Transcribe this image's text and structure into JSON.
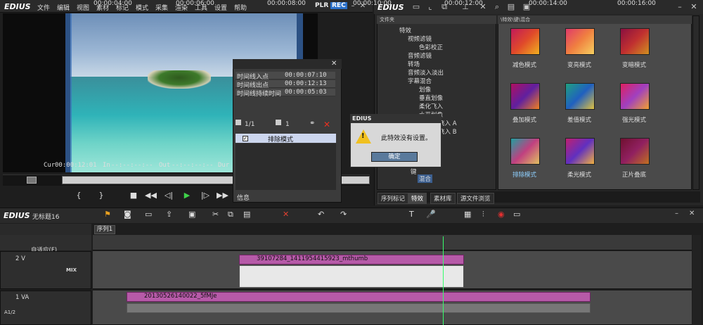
{
  "app": {
    "name": "EDIUS"
  },
  "menu": [
    "文件",
    "编辑",
    "视图",
    "素材",
    "标记",
    "模式",
    "采集",
    "渲染",
    "工具",
    "设置",
    "帮助"
  ],
  "player_badges": {
    "plr": "PLR",
    "rec": "REC"
  },
  "timecodes": {
    "cur_label": "Cur",
    "cur": "00:00:12:01",
    "in_label": "In",
    "in": "--:--:--:--",
    "out_label": "Out",
    "out": "--:--:--:--",
    "dur_label": "Dur"
  },
  "folder_panel": {
    "header": "文件夹",
    "items": [
      "特效",
      "视频滤镜",
      "色彩校正",
      "音频滤镜",
      "转场",
      "音频淡入淡出",
      "字幕混合",
      "划像",
      "垂直划像",
      "柔化飞入",
      "水平划像",
      "飞入 A",
      "飞入 B",
      "键",
      "混合"
    ]
  },
  "fx_panel": {
    "header": "\\特效\\键\\混合",
    "items": [
      "减色模式",
      "变亮模式",
      "变暗模式",
      "叠加模式",
      "差值模式",
      "强光模式",
      "排除模式",
      "柔光模式",
      "正片叠底"
    ],
    "selected": "排除模式"
  },
  "tabs": [
    "序列标记",
    "特效",
    "素材库",
    "源文件浏览"
  ],
  "info_dialog": {
    "rows": [
      {
        "label": "时间线入点",
        "value": "00:00:07:10"
      },
      {
        "label": "时间线出点",
        "value": "00:00:12:13"
      },
      {
        "label": "时间线持续时间",
        "value": "00:00:05:03"
      }
    ],
    "counter_left": "1/1",
    "counter_right": "1",
    "effect_item": "排除模式",
    "footer": "信息"
  },
  "alert_dialog": {
    "title": "EDIUS",
    "message": "此特效没有设置。",
    "ok": "确定"
  },
  "timeline": {
    "logo": "EDIUS",
    "project": "无标题16",
    "sequence_tab": "序列1",
    "mode": "自适应(F)",
    "ruler": [
      "00:00:04:00",
      "00:00:06:00",
      "00:00:08:00",
      "00:00:10:00",
      "00:00:12:00",
      "00:00:14:00",
      "00:00:16:00"
    ],
    "tracks": [
      {
        "label": "2 V",
        "mix": "MIX",
        "clip": "39107284_1411954415923_mthumb"
      },
      {
        "label": "1 VA",
        "clip": "20130526140022_5fMJe"
      }
    ],
    "a_track": "A1/2"
  }
}
